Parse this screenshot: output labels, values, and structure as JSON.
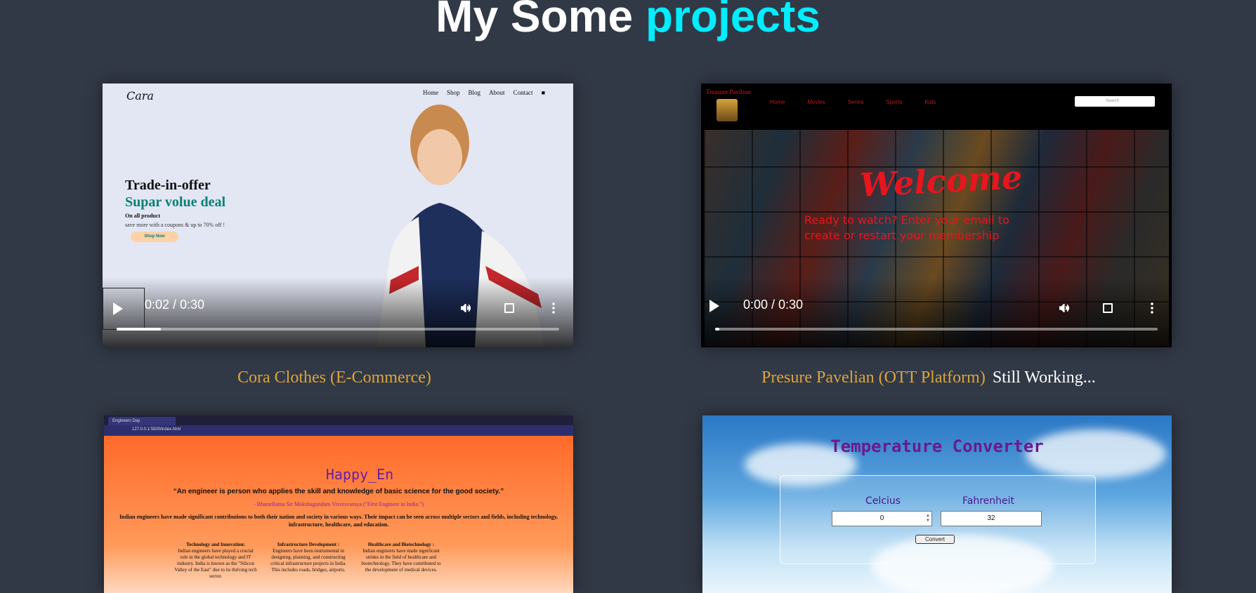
{
  "header": {
    "title_main": "My Some ",
    "title_accent": "projects"
  },
  "projects": [
    {
      "caption": "Cora Clothes (E-Commerce)",
      "note": "",
      "preview": {
        "logo": "Cara",
        "menu": [
          "Home",
          "Shop",
          "Blog",
          "About",
          "Contact"
        ],
        "heading1": "Trade-in-offer",
        "heading2": "Supar volue deal",
        "line1": "On all product",
        "line2": "save more with a coupons & up to 70% off !",
        "button": "Shop Now"
      },
      "video": {
        "time": "0:02 / 0:30",
        "progress": 0.1
      }
    },
    {
      "caption": "Presure Pavelian (OTT Platform)",
      "note": "Still Working...",
      "preview": {
        "brand": "Treasure Pavilion",
        "menu": [
          "Home",
          "Movies",
          "Series",
          "Sports",
          "Kids"
        ],
        "search_placeholder": "Search",
        "welcome": "Welcome",
        "tagline": "Ready to watch? Enter your email to create or restart your membership"
      },
      "video": {
        "time": "0:00 / 0:30",
        "progress": 0.0
      }
    },
    {
      "caption": "",
      "note": "",
      "preview": {
        "tab_title": "Engineers Day",
        "url": "127.0.0.1:5500/index.html",
        "heading": "Happy_En",
        "quote": "“An engineer is person who applies the skill and knowledge of basic science for the good society.”",
        "attribution": "- BharatRatna Sir Mokshagundam Visvesvaraya (\"First Engineer in India.\")",
        "paragraph": "Indian engineers have made significant contributions to both their nation and society in various ways. Their impact can be seen across multiple sectors and fields, including technology, infrastructure, healthcare, and education.",
        "columns": [
          {
            "title": "Technology and Innovation:",
            "text": "Indian engineers have played a crucial role in the global technology and IT industry. India is known as the \"Silicon Valley of the East\" due to its thriving tech sector."
          },
          {
            "title": "Infrastructure Development :",
            "text": "Engineers have been instrumental in designing, planning, and constructing critical infrastructure projects in India. This includes roads, bridges, airports."
          },
          {
            "title": "Healthcare and Biotechnology :",
            "text": "Indian engineers have made significant strides in the field of healthcare and biotechnology. They have contributed to the development of medical devices."
          }
        ]
      }
    },
    {
      "caption": "",
      "note": "",
      "preview": {
        "title": "Temperature Converter",
        "label_c": "Celcius",
        "label_f": "Fahrenheit",
        "value_c": "0",
        "value_f": "32",
        "button": "Convert"
      }
    }
  ]
}
